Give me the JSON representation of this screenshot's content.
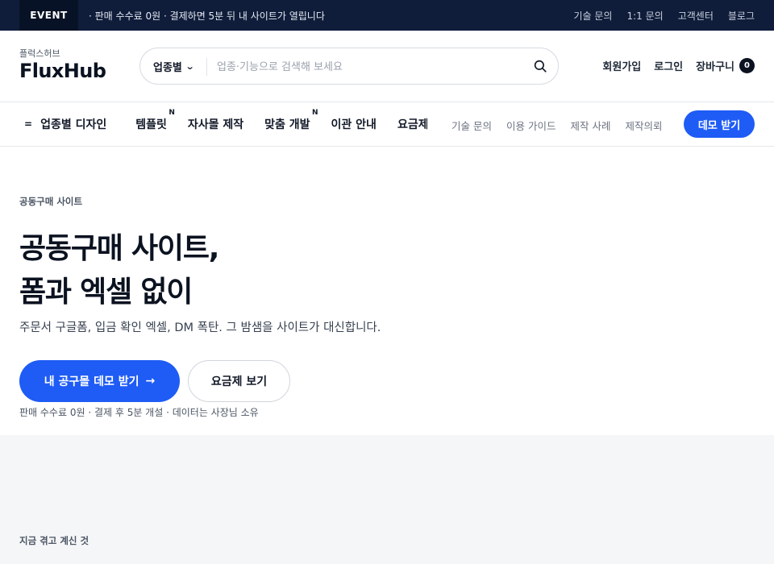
{
  "topbar": {
    "event_label": "EVENT",
    "event_text": "· 판매 수수료 0원 · 결제하면 5분 뒤 내 사이트가 열립니다",
    "links": [
      "기술 문의",
      "1:1 문의",
      "고객센터",
      "블로그"
    ]
  },
  "header": {
    "logo_small": "플럭스허브",
    "logo_main": "FluxHub",
    "search": {
      "category": "업종별",
      "placeholder": "업종·기능으로 검색해 보세요"
    },
    "signup": "회원가입",
    "login": "로그인",
    "cart_label": "장바구니",
    "cart_count": "0"
  },
  "nav": {
    "items": [
      {
        "label": "업종별 디자인",
        "badge": ""
      },
      {
        "label": "템플릿",
        "badge": "N"
      },
      {
        "label": "자사몰 제작",
        "badge": ""
      },
      {
        "label": "맞춤 개발",
        "badge": "N"
      },
      {
        "label": "이관 안내",
        "badge": ""
      },
      {
        "label": "요금제",
        "badge": ""
      }
    ],
    "sub_links": [
      "기술 문의",
      "이용 가이드",
      "제작 사례",
      "제작의뢰"
    ],
    "demo_button": "데모 받기"
  },
  "hero": {
    "eyebrow": "공동구매 사이트",
    "title_line1": "공동구매 사이트,",
    "title_line2": "폼과 엑셀 없이",
    "subtitle": "주문서 구글폼, 입금 확인 엑셀, DM 폭탄. 그 밤샘을 사이트가 대신합니다.",
    "cta_primary": "내 공구몰 데모 받기",
    "cta_secondary": "요금제 보기",
    "note": "판매 수수료 0원 · 결제 후 5분 개설 · 데이터는 사장님 소유"
  },
  "lower": {
    "eyebrow": "지금 겪고 계신 것"
  },
  "colors": {
    "topbar_bg": "#0f1d3a",
    "accent": "#1f5cf5",
    "text_dark": "#0b1220"
  }
}
